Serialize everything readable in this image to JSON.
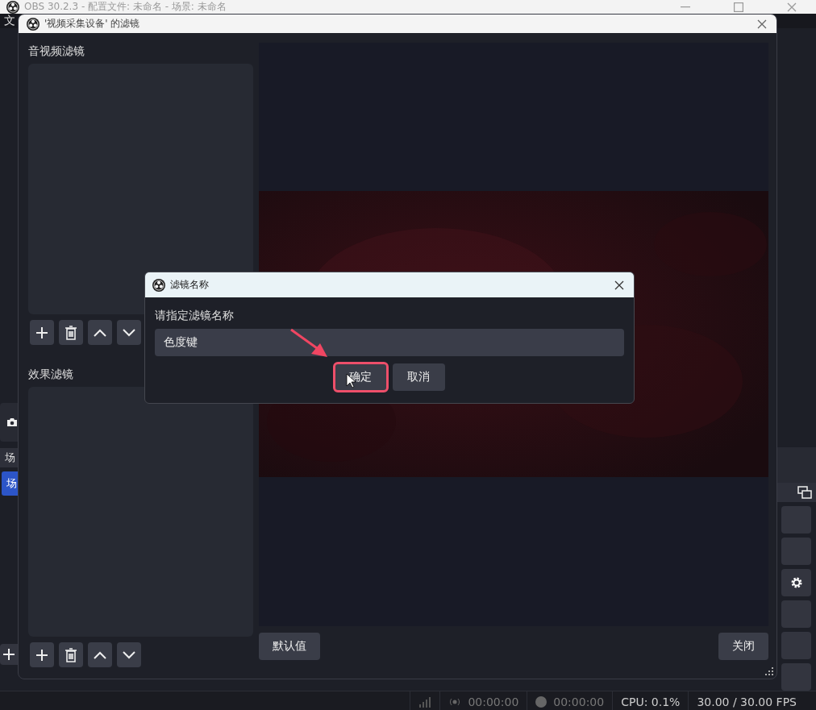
{
  "main_window": {
    "title": "OBS 30.2.3 - 配置文件: 未命名 - 场景: 未命名",
    "menu": [
      "文"
    ],
    "scenes_header": "场",
    "scenes": [
      {
        "label": "场",
        "selected": true
      }
    ],
    "status_bar": {
      "stream_time": "00:00:00",
      "record_time": "00:00:00",
      "cpu": "CPU: 0.1%",
      "fps": "30.00 / 30.00 FPS"
    }
  },
  "filters_window": {
    "title": "'视频采集设备' 的滤镜",
    "audio_video_filters_label": "音视频滤镜",
    "effect_filters_label": "效果滤镜",
    "buttons": [
      "默认值",
      "关闭"
    ]
  },
  "dialog": {
    "title": "滤镜名称",
    "prompt": "请指定滤镜名称",
    "name_field": {
      "value": "色度键"
    },
    "buttons": [
      {
        "label": "确定",
        "highlighted": true
      },
      {
        "label": "取消",
        "highlighted": false
      }
    ]
  }
}
